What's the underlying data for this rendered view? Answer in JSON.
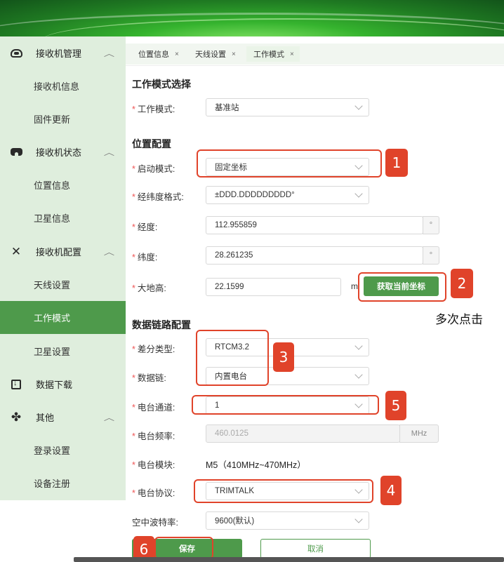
{
  "sidebar": {
    "groups": [
      {
        "label": "接收机管理",
        "icon": "headset-icon",
        "items": [
          "接收机信息",
          "固件更新"
        ]
      },
      {
        "label": "接收机状态",
        "icon": "vr-icon",
        "items": [
          "位置信息",
          "卫星信息"
        ]
      },
      {
        "label": "接收机配置",
        "icon": "tools-icon",
        "items": [
          "天线设置",
          "工作模式",
          "卫星设置"
        ]
      },
      {
        "label": "数据下载",
        "icon": "download-icon",
        "items": []
      },
      {
        "label": "其他",
        "icon": "clover-icon",
        "items": [
          "登录设置",
          "设备注册"
        ]
      }
    ],
    "active_item": "工作模式"
  },
  "tabs": [
    {
      "label": "位置信息",
      "close": "×"
    },
    {
      "label": "天线设置",
      "close": "×"
    },
    {
      "label": "工作模式",
      "close": "×",
      "active": true
    }
  ],
  "sections": {
    "mode": "工作模式选择",
    "position": "位置配置",
    "datalink": "数据链路配置"
  },
  "fields": {
    "work_mode": {
      "label": "工作模式:",
      "value": "基准站"
    },
    "start_mode": {
      "label": "启动模式:",
      "value": "固定坐标"
    },
    "coord_format": {
      "label": "经纬度格式:",
      "value": "±DDD.DDDDDDDDD°"
    },
    "longitude": {
      "label": "经度:",
      "value": "112.955859",
      "unit": "°"
    },
    "latitude": {
      "label": "纬度:",
      "value": "28.261235",
      "unit": "°"
    },
    "height": {
      "label": "大地高:",
      "value": "22.1599",
      "unit": "m"
    },
    "diff_type": {
      "label": "差分类型:",
      "value": "RTCM3.2"
    },
    "datalink": {
      "label": "数据链:",
      "value": "内置电台"
    },
    "radio_channel": {
      "label": "电台通道:",
      "value": "1"
    },
    "radio_freq": {
      "label": "电台频率:",
      "value": "460.0125",
      "unit": "MHz"
    },
    "radio_module": {
      "label": "电台模块:",
      "value": "M5（410MHz~470MHz）"
    },
    "radio_protocol": {
      "label": "电台协议:",
      "value": "TRIMTALK"
    },
    "baud_rate": {
      "label": "空中波特率:",
      "value": "9600(默认)"
    }
  },
  "buttons": {
    "get_coords": "获取当前坐标",
    "save": "保存",
    "cancel": "取消"
  },
  "annotations": {
    "badges": [
      "1",
      "2",
      "3",
      "4",
      "5",
      "6"
    ],
    "note": "多次点击",
    "color": "#e0432a"
  },
  "colors": {
    "brand_green": "#4e9a4b",
    "sidebar_bg": "#dfeedd",
    "required_star": "#e55555"
  }
}
